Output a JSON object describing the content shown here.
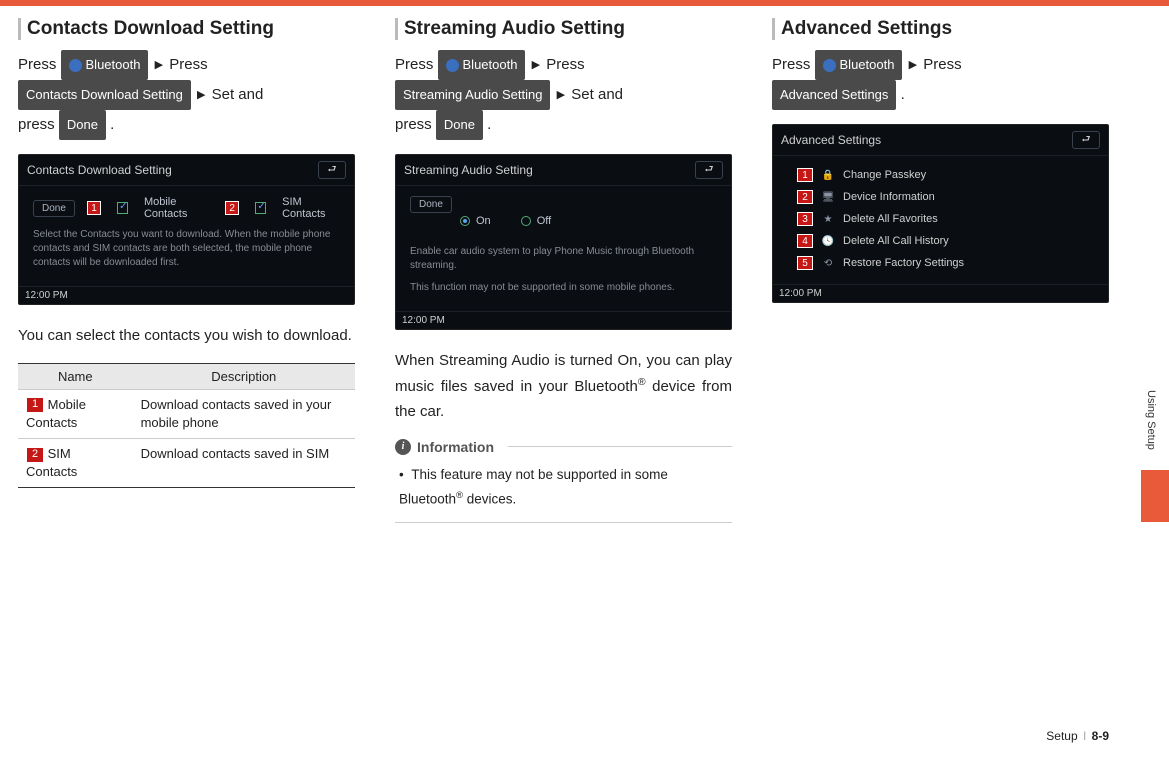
{
  "col1": {
    "heading": "Contacts Download Setting",
    "instr_press1": "Press",
    "chip_bt": "Bluetooth",
    "instr_press2": "Press",
    "chip_a": "Contacts Download Setting",
    "instr_setand": "Set and",
    "instr_press3": "press",
    "chip_done": "Done",
    "instr_end": ".",
    "shot": {
      "title": "Contacts Download Setting",
      "done": "Done",
      "opt1": "Mobile Contacts",
      "c1": "1",
      "opt2": "SIM Contacts",
      "c2": "2",
      "help": "Select the Contacts you want to download. When the mobile phone contacts and SIM contacts are both selected, the mobile phone contacts will be downloaded first.",
      "time": "12:00 PM"
    },
    "body": "You can select the contacts you wish to download.",
    "table": {
      "h1": "Name",
      "h2": "Description",
      "r1n": "1",
      "r1a": "Mobile Contacts",
      "r1b": "Download contacts saved in your mobile phone",
      "r2n": "2",
      "r2a": "SIM Contacts",
      "r2b": "Download contacts saved in SIM"
    }
  },
  "col2": {
    "heading": "Streaming Audio Setting",
    "instr_press1": "Press",
    "chip_bt": "Bluetooth",
    "instr_press2": "Press",
    "chip_a": "Streaming Audio Setting",
    "instr_setand": "Set and",
    "instr_press3": "press",
    "chip_done": "Done",
    "instr_end": ".",
    "shot": {
      "title": "Streaming Audio Setting",
      "done": "Done",
      "on": "On",
      "off": "Off",
      "help1": "Enable car audio system to play Phone Music through Bluetooth streaming.",
      "help2": "This function may not be supported in some mobile phones.",
      "time": "12:00 PM"
    },
    "body": "When Streaming Audio is turned On, you can play music files saved in your Bluetooth® device from the car.",
    "info_title": "Information",
    "info_bullet": "This feature may not be supported in some Bluetooth® devices."
  },
  "col3": {
    "heading": "Advanced Settings",
    "instr_press1": "Press",
    "chip_bt": "Bluetooth",
    "instr_press2": "Press",
    "chip_a": "Advanced Settings",
    "instr_end": ".",
    "shot": {
      "title": "Advanced Settings",
      "rows": {
        "r1n": "1",
        "r1": "Change Passkey",
        "r2n": "2",
        "r2": "Device Information",
        "r3n": "3",
        "r3": "Delete All Favorites",
        "r4n": "4",
        "r4": "Delete All Call History",
        "r5n": "5",
        "r5": "Restore Factory Settings"
      },
      "time": "12:00 PM"
    }
  },
  "side": "Using Setup",
  "footer_a": "Setup",
  "footer_b": "8-9"
}
